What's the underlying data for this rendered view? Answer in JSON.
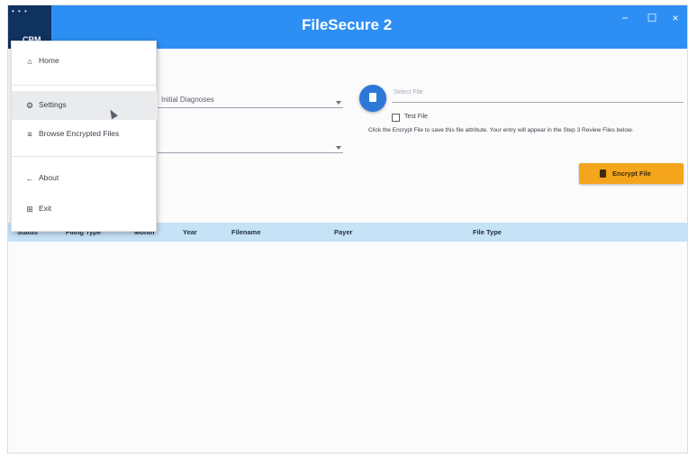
{
  "window": {
    "title": "FileSecure 2",
    "logo_text": "CRM",
    "minimize": "−",
    "maximize": "☐",
    "close": "×"
  },
  "form": {
    "type_value": "Initial Diagnoses",
    "select_file_placeholder": "Select File",
    "test_file_label": "Test File",
    "test_file_checked": false,
    "instruction": "Click the Encrypt File to save this file attribute. Your entry will appear in the Step 3 Review Files below.",
    "encrypt_label": "Encrypt File"
  },
  "table": {
    "columns": [
      "Status",
      "Filing Type",
      "Month",
      "Year",
      "Filename",
      "Payer",
      "File Type"
    ],
    "rows": []
  },
  "menu": {
    "items": [
      {
        "label": "Home",
        "icon": "home-icon",
        "glyph": "⌂"
      },
      {
        "label": "Settings",
        "icon": "gear-icon",
        "glyph": "⚙"
      },
      {
        "label": "Browse Encrypted Files",
        "icon": "list-icon",
        "glyph": "≡"
      },
      {
        "label": "About",
        "icon": "back-arrow-icon",
        "glyph": "←"
      },
      {
        "label": "Exit",
        "icon": "exit-icon",
        "glyph": "⊞"
      }
    ],
    "active_index": 1
  },
  "colors": {
    "titlebar": "#2d8ff4",
    "logo_bg": "#10325e",
    "accent_button": "#2d77d6",
    "encrypt_button": "#f4a51c",
    "table_header": "#c6e2f7"
  }
}
